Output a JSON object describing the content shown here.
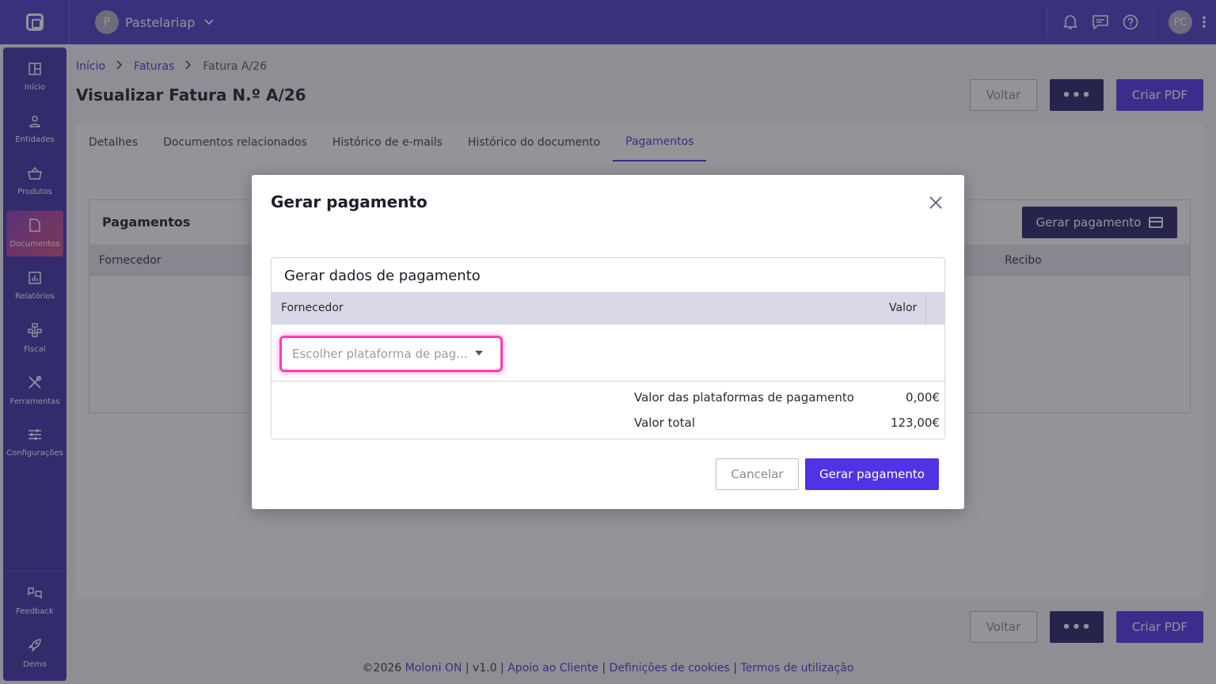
{
  "topbar": {
    "company_initial": "P",
    "company_name": "Pastelariap",
    "user_initials": "PC"
  },
  "sidebar": {
    "items": [
      {
        "label": "Início",
        "icon": "dashboard-icon"
      },
      {
        "label": "Entidades",
        "icon": "person-icon"
      },
      {
        "label": "Produtos",
        "icon": "basket-icon"
      },
      {
        "label": "Documentos",
        "icon": "document-icon"
      },
      {
        "label": "Relatórios",
        "icon": "chart-icon"
      },
      {
        "label": "Fiscal",
        "icon": "tree-icon"
      },
      {
        "label": "Ferramentas",
        "icon": "tools-icon"
      },
      {
        "label": "Configurações",
        "icon": "sliders-icon"
      }
    ],
    "bottom": [
      {
        "label": "Feedback",
        "icon": "feedback-icon"
      },
      {
        "label": "Demo",
        "icon": "rocket-icon"
      }
    ]
  },
  "breadcrumb": {
    "home": "Início",
    "section": "Faturas",
    "current": "Fatura A/26"
  },
  "page": {
    "title": "Visualizar Fatura N.º A/26"
  },
  "actions": {
    "back": "Voltar",
    "more": "•••",
    "pdf": "Criar PDF"
  },
  "tabs": [
    "Detalhes",
    "Documentos relacionados",
    "Histórico de e-mails",
    "Histórico do documento",
    "Pagamentos"
  ],
  "payments": {
    "title": "Pagamentos",
    "generate_button": "Gerar pagamento",
    "col_supplier": "Fornecedor",
    "col_receipt": "Recibo"
  },
  "modal": {
    "title": "Gerar pagamento",
    "section_title": "Gerar dados de pagamento",
    "col_supplier": "Fornecedor",
    "col_value": "Valor",
    "select_placeholder": "Escolher plataforma de pag...",
    "platforms_label": "Valor das plataformas de pagamento",
    "platforms_value": "0,00€",
    "total_label": "Valor total",
    "total_value": "123,00€",
    "cancel": "Cancelar",
    "confirm": "Gerar pagamento"
  },
  "footer": {
    "copyright": "©2026 ",
    "brand": "Moloni ON",
    "version": " | v1.0 | ",
    "support": "Apoio ao Cliente",
    "sep": " | ",
    "cookies": "Definições de cookies",
    "terms": "Termos de utilização"
  }
}
